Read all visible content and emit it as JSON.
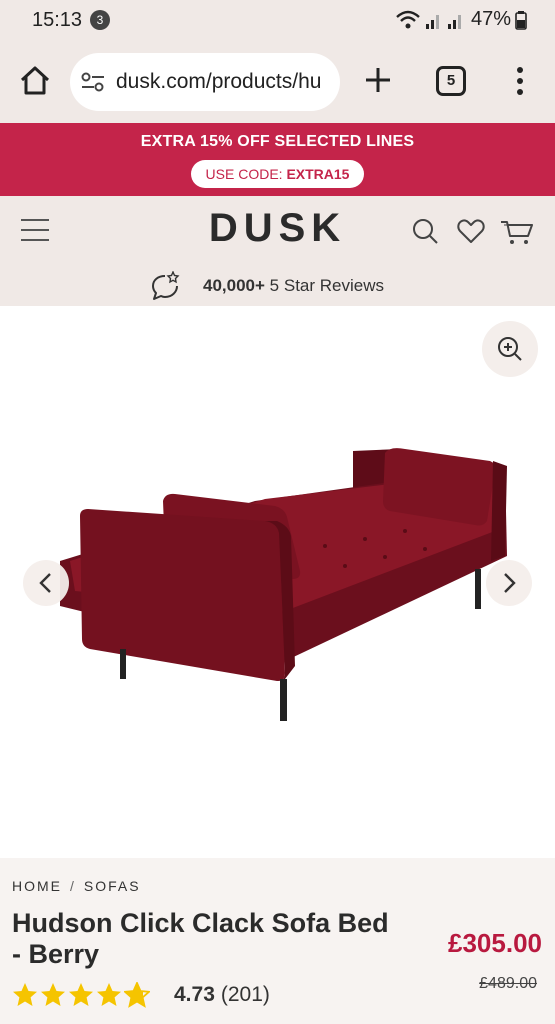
{
  "status_bar": {
    "time": "15:13",
    "notification_count": "3",
    "battery": "47%"
  },
  "browser": {
    "url": "dusk.com/products/hu",
    "tab_count": "5"
  },
  "promo": {
    "title": "EXTRA 15% OFF SELECTED LINES",
    "code_label": "USE CODE: ",
    "code": "EXTRA15",
    "background": "#c4244a"
  },
  "header": {
    "logo": "DUSK"
  },
  "reviews": {
    "count": "40,000+",
    "label": "5 Star Reviews"
  },
  "breadcrumb": [
    "HOME",
    "SOFAS"
  ],
  "product": {
    "title": "Hudson Click Clack Sofa Bed - Berry",
    "price": "£305.00",
    "was_price": "£489.00",
    "rating": "4.73",
    "rating_count": "(201)",
    "star_fill": 0.73,
    "sofa_color": "#7a1222"
  }
}
